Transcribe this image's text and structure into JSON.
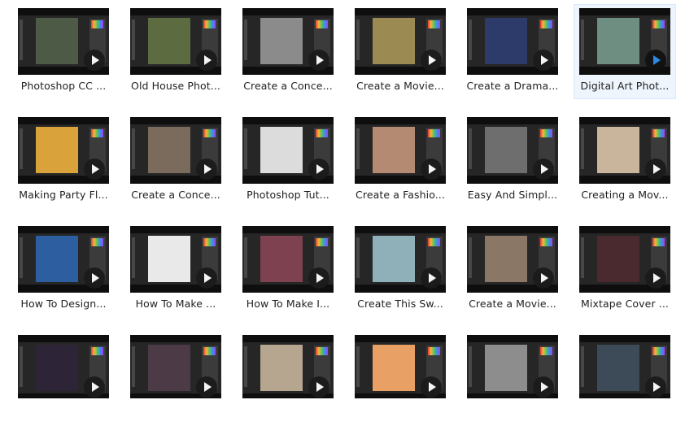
{
  "videos": [
    {
      "title": "Photoshop CC ...",
      "art": "#4d5a45",
      "selected": false
    },
    {
      "title": "Old House Phot...",
      "art": "#5d6b40",
      "selected": false
    },
    {
      "title": "Create a Conce...",
      "art": "#8b8b8b",
      "selected": false
    },
    {
      "title": "Create a Movie...",
      "art": "#9b8a52",
      "selected": false
    },
    {
      "title": "Create a Drama...",
      "art": "#2c3b6a",
      "selected": false
    },
    {
      "title": "Digital Art Phot...",
      "art": "#6f8e82",
      "selected": true
    },
    {
      "title": "Making Party Fl...",
      "art": "#d9a23a",
      "selected": false
    },
    {
      "title": "Create a Conce...",
      "art": "#7b6b5d",
      "selected": false
    },
    {
      "title": "Photoshop Tut...",
      "art": "#dcdcdc",
      "selected": false
    },
    {
      "title": "Create a Fashio...",
      "art": "#b58a73",
      "selected": false
    },
    {
      "title": "Easy And Simpl...",
      "art": "#6e6e6e",
      "selected": false
    },
    {
      "title": "Creating a Mov...",
      "art": "#c8b59b",
      "selected": false
    },
    {
      "title": "How To Design...",
      "art": "#2d5fa0",
      "selected": false
    },
    {
      "title": "How To Make ...",
      "art": "#e9e9e9",
      "selected": false
    },
    {
      "title": "How To Make I...",
      "art": "#7d4150",
      "selected": false
    },
    {
      "title": "Create This  Sw...",
      "art": "#8fb0b8",
      "selected": false
    },
    {
      "title": "Create a Movie...",
      "art": "#8b7766",
      "selected": false
    },
    {
      "title": "Mixtape Cover ...",
      "art": "#4a2a2e",
      "selected": false
    },
    {
      "title": "",
      "art": "#2d2438",
      "selected": false
    },
    {
      "title": "",
      "art": "#4c3a47",
      "selected": false
    },
    {
      "title": "",
      "art": "#b6a58f",
      "selected": false
    },
    {
      "title": "",
      "art": "#e8a064",
      "selected": false
    },
    {
      "title": "",
      "art": "#8d8d8d",
      "selected": false
    },
    {
      "title": "",
      "art": "#3d4a57",
      "selected": false
    }
  ]
}
